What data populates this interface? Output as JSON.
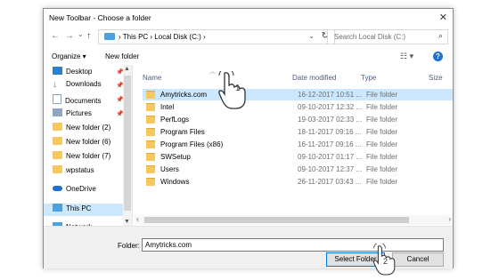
{
  "window": {
    "title": "New Toolbar - Choose a folder",
    "close_glyph": "✕"
  },
  "nav": {
    "back": "←",
    "forward": "→",
    "recent": "⌄",
    "up": "↑"
  },
  "address": {
    "crumbs": "›  This PC  ›  Local Disk (C:)  ›",
    "dropdown": "⌄",
    "refresh": "↻"
  },
  "search": {
    "placeholder": "Search Local Disk (C:)",
    "icon": "⌕"
  },
  "commands": {
    "organize": "Organize ▾",
    "new_folder": "New folder",
    "view": "☷ ▾",
    "help": "?"
  },
  "sidebar": {
    "items": [
      {
        "label": "Desktop",
        "pinned": true,
        "icon": "desktop-icon",
        "color": "#2b7fd4"
      },
      {
        "label": "Downloads",
        "pinned": true,
        "icon": "download-icon",
        "color": "#2b7fd4"
      },
      {
        "label": "Documents",
        "pinned": true,
        "icon": "documents-icon",
        "color": "#8ea6c4"
      },
      {
        "label": "Pictures",
        "pinned": true,
        "icon": "pictures-icon",
        "color": "#8ea6c4"
      },
      {
        "label": "New folder (2)",
        "pinned": false,
        "icon": "folder-icon",
        "color": "#f7c85b"
      },
      {
        "label": "New folder (6)",
        "pinned": false,
        "icon": "folder-icon",
        "color": "#f7c85b"
      },
      {
        "label": "New folder (7)",
        "pinned": false,
        "icon": "folder-icon",
        "color": "#f7c85b"
      },
      {
        "label": "wpstatus",
        "pinned": false,
        "icon": "folder-icon",
        "color": "#f7c85b"
      },
      {
        "label": "OneDrive",
        "pinned": false,
        "icon": "cloud-icon",
        "color": "#1e6fcf"
      },
      {
        "label": "This PC",
        "pinned": false,
        "icon": "computer-icon",
        "color": "#4aa3df"
      },
      {
        "label": "Network",
        "pinned": false,
        "icon": "network-icon",
        "color": "#4aa3df"
      }
    ],
    "pin_glyph": "📌"
  },
  "table": {
    "columns": [
      "Name",
      "Date modified",
      "Type",
      "Size"
    ],
    "rows": [
      {
        "name": "Amytricks.com",
        "date": "16-12-2017 10:51 ...",
        "type": "File folder",
        "selected": true
      },
      {
        "name": "Intel",
        "date": "09-10-2017 12:32 ...",
        "type": "File folder"
      },
      {
        "name": "PerfLogs",
        "date": "19-03-2017 02:33 ...",
        "type": "File folder"
      },
      {
        "name": "Program Files",
        "date": "18-11-2017 09:16 ...",
        "type": "File folder"
      },
      {
        "name": "Program Files (x86)",
        "date": "16-11-2017 09:16 ...",
        "type": "File folder"
      },
      {
        "name": "SWSetup",
        "date": "09-10-2017 01:17 ...",
        "type": "File folder"
      },
      {
        "name": "Users",
        "date": "09-10-2017 12:37 ...",
        "type": "File folder"
      },
      {
        "name": "Windows",
        "date": "26-11-2017 03:43 ...",
        "type": "File folder"
      }
    ]
  },
  "footer": {
    "folder_label": "Folder:",
    "folder_value": "Amytricks.com",
    "select_button": "Select Folder",
    "cancel_button": "Cancel"
  },
  "annotations": {
    "step1": "1",
    "step2": "2"
  }
}
